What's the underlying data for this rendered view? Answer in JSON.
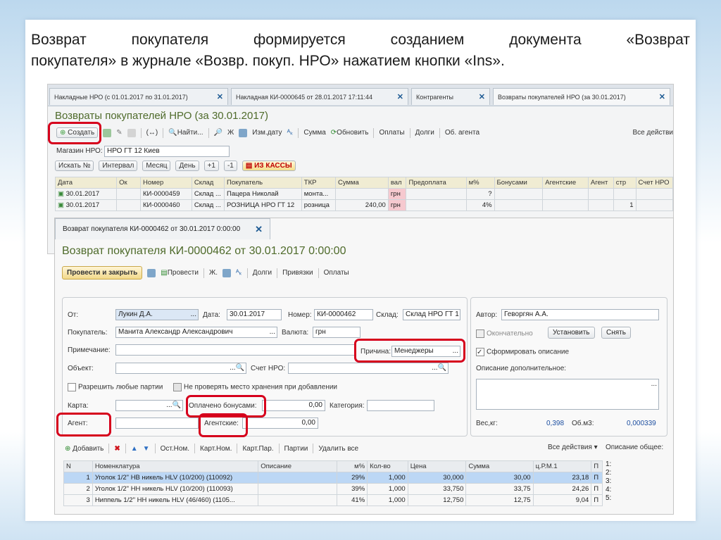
{
  "heading": {
    "line1_words": [
      "Возврат",
      "покупателя",
      "формируется",
      "созданием",
      "документа",
      "«Возврат"
    ],
    "line2": "покупателя» в журнале «Возвр. покуп. НРО» нажатием кнопки «Ins»."
  },
  "tabs": [
    {
      "label": "Накладные НРО  (с 01.01.2017 по 31.01.2017)"
    },
    {
      "label": "Накладная КИ-0000645 от 28.01.2017 17:11:44"
    },
    {
      "label": "Контрагенты"
    },
    {
      "label": "Возвраты покупателей НРО  (за 30.01.2017)"
    }
  ],
  "journal": {
    "title": "Возвраты покупателей НРО   (за 30.01.2017)",
    "toolbar": {
      "create": "Создать",
      "find": "Найти...",
      "zh": "Ж",
      "change_date": "Изм.дату",
      "sum": "Сумма",
      "refresh": "Обновить",
      "payments": "Оплаты",
      "debts": "Долги",
      "agent": "Об. агента",
      "all_actions": "Все действи"
    },
    "store_label": "Магазин НРО:",
    "store_value": "НРО ГТ 12 Киев",
    "filters": {
      "search": "Искать №",
      "interval": "Интервал",
      "month": "Месяц",
      "day": "День",
      "plus": "+1",
      "minus": "-1",
      "from_cash": "ИЗ КАССЫ"
    },
    "columns": [
      "Дата",
      "Ок",
      "Номер",
      "Склад",
      "Покупатель",
      "ТКР",
      "Сумма",
      "вал",
      "Предоплата",
      "м%",
      "Бонусами",
      "Агентские",
      "Агент",
      "стр",
      "Счет НРО"
    ],
    "rows": [
      [
        "30.01.2017",
        "",
        "КИ-0000459",
        "Склад ...",
        "Пацера Николай",
        "монта...",
        "",
        "грн",
        "",
        "?",
        "",
        "",
        "",
        "",
        ""
      ],
      [
        "30.01.2017",
        "",
        "КИ-0000460",
        "Склад ...",
        "РОЗНИЦА НРО ГТ 12",
        "розница",
        "240,00",
        "грн",
        "",
        "4%",
        "",
        "",
        "",
        "1",
        ""
      ]
    ]
  },
  "dialog": {
    "tab_label": "Возврат покупателя КИ-0000462 от 30.01.2017 0:00:00",
    "title": "Возврат покупателя КИ-0000462 от 30.01.2017 0:00:00",
    "toolbar": {
      "post_close": "Провести и закрыть",
      "post": "Провести",
      "zh": "Ж.",
      "debts": "Долги",
      "links": "Привязки",
      "payments": "Оплаты"
    },
    "from_label": "От:",
    "from_value": "Лукин Д.А.",
    "date_label": "Дата:",
    "date_value": "30.01.2017",
    "number_label": "Номер:",
    "number_value": "КИ-0000462",
    "warehouse_label": "Склад:",
    "warehouse_value": "Склад НРО ГТ 1",
    "buyer_label": "Покупатель:",
    "buyer_value": "Манита Александр Александрович",
    "currency_label": "Валюта:",
    "currency_value": "грн",
    "note_label": "Примечание:",
    "reason_label": "Причина:",
    "reason_value": "Менеджеры",
    "object_label": "Объект:",
    "account_label": "Счет НРО:",
    "allow_batches": "Разрешить любые партии",
    "no_check_storage": "Не проверять место хранения при добавлении",
    "card_label": "Карта:",
    "bonus_label": "Оплачено бонусами:",
    "bonus_value": "0,00",
    "category_label": "Категория:",
    "agent_label": "Агент:",
    "agent_fee_label": "Агентские:",
    "agent_fee_value": "0,00",
    "author_label": "Автор:",
    "author_value": "Геворгян А.А.",
    "final_label": "Окончательно",
    "set_btn": "Установить",
    "remove_btn": "Снять",
    "form_desc": "Сформировать описание",
    "extra_desc": "Описание дополнительное:",
    "weight_label": "Вес,кг:",
    "weight_value": "0,398",
    "volume_label": "Об.м3:",
    "volume_value": "0,000339",
    "lines_toolbar": {
      "add": "Добавить",
      "ost": "Ост.Ном.",
      "kart_nom": "Карт.Ном.",
      "kart_par": "Карт.Пар.",
      "batches": "Партии",
      "delete_all": "Удалить все",
      "all_actions": "Все действия",
      "desc_general": "Описание общее:"
    },
    "columns": [
      "N",
      "Номенклатура",
      "Описание",
      "м%",
      "Кол-во",
      "Цена",
      "Сумма",
      "ц.Р.М.1",
      "П"
    ],
    "rows": [
      [
        "1",
        "Уголок 1/2\" НВ никель HLV (10/200) (110092)",
        "",
        "29%",
        "1,000",
        "30,000",
        "30,00",
        "23,18",
        "П"
      ],
      [
        "2",
        "Уголок 1/2\" НН никель HLV (10/200) (110093)",
        "",
        "39%",
        "1,000",
        "33,750",
        "33,75",
        "24,26",
        "П"
      ],
      [
        "3",
        "Ниппель 1/2\" НН никель HLV (46/460) (1105...",
        "",
        "41%",
        "1,000",
        "12,750",
        "12,75",
        "9,04",
        "П"
      ]
    ],
    "side_list": [
      "1:",
      "2:",
      "3:",
      "4:",
      "5:"
    ]
  }
}
